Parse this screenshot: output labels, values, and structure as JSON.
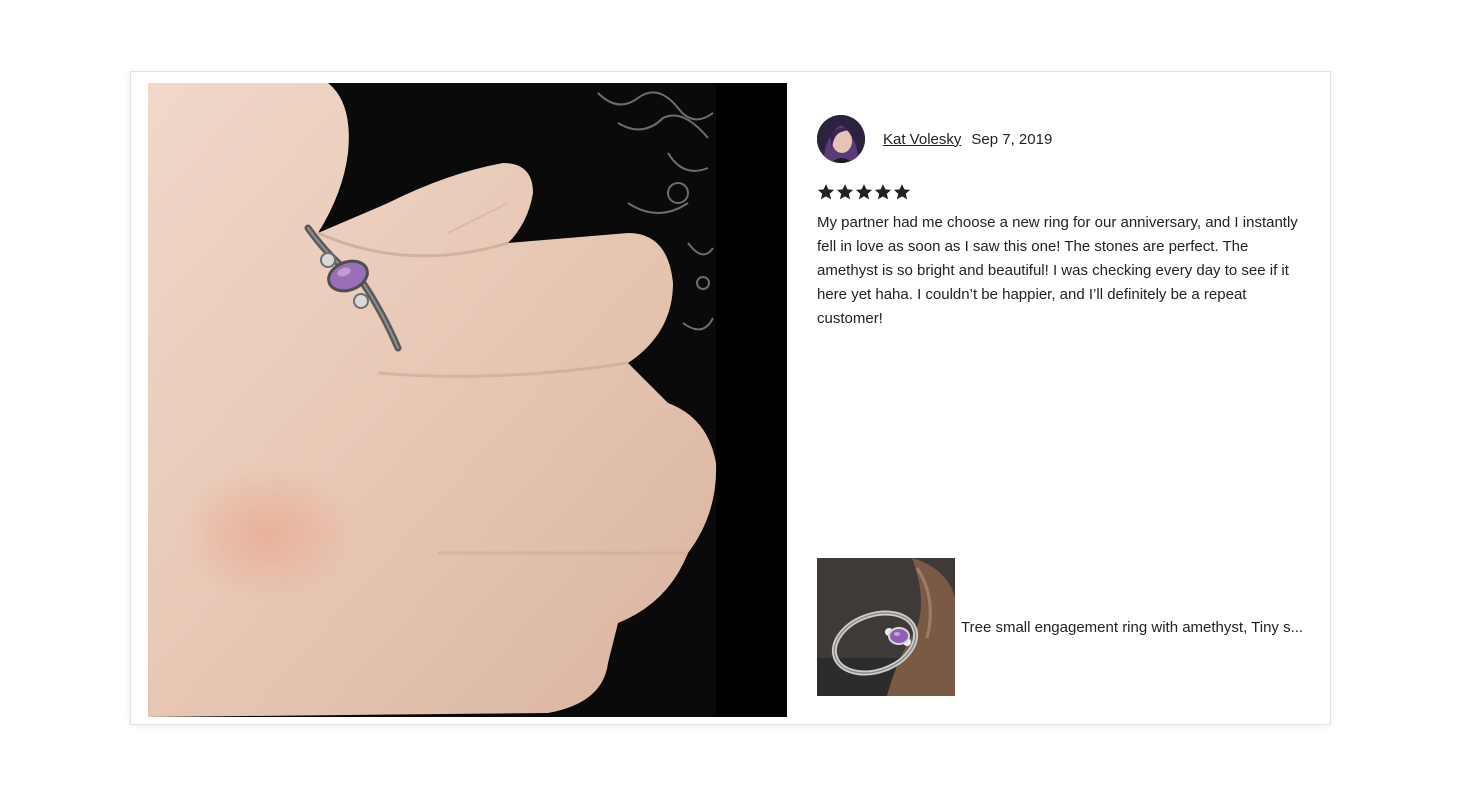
{
  "review": {
    "reviewer_name": "Kat Volesky",
    "date": "Sep 7, 2019",
    "rating": 5,
    "rating_max": 5,
    "text": "My partner had me choose a new ring for our anniversary, and I instantly fell in love as soon as I saw this one! The stones are perfect. The amethyst is so bright and beautiful! I was checking every day to see if it here yet haha. I couldn’t be happier, and I’ll definitely be a repeat customer!"
  },
  "product": {
    "title": "Tree small engagement ring with amethyst, Tiny s..."
  },
  "colors": {
    "star": "#222222",
    "amethyst": "#9a6fb8",
    "skin": "#e8c9b8",
    "photo_background": "#000000"
  },
  "icons": {
    "star": "star-icon"
  }
}
